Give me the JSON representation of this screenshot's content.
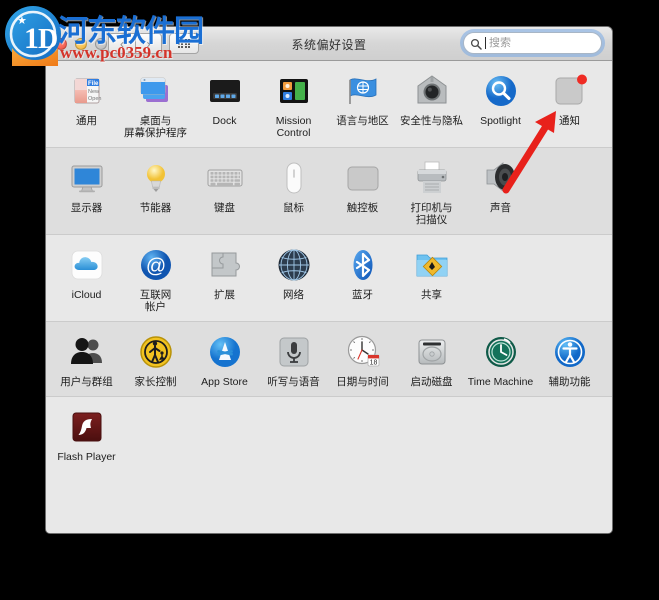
{
  "window": {
    "title": "系统偏好设置",
    "traffic_lights": [
      "close",
      "minimize",
      "zoom"
    ],
    "nav_back_label": "‹",
    "nav_forward_label": "›",
    "grid_button_name": "show-all"
  },
  "search": {
    "placeholder": "搜索",
    "value": "",
    "icon": "search-icon",
    "clear_icon": "clear-icon"
  },
  "watermark": {
    "site_name": "河东软件园",
    "url": "www.pc0359.cn",
    "brand_color": "#1a6fd4",
    "url_color": "#d4342a"
  },
  "annotation": {
    "arrow_color": "#e8211b",
    "points_to": "通知"
  },
  "sections": [
    {
      "name": "personal",
      "shade": "lite",
      "items": [
        {
          "label": "通用",
          "icon": "general-icon"
        },
        {
          "label": "桌面与\n屏幕保护程序",
          "icon": "desktop-screensaver-icon"
        },
        {
          "label": "Dock",
          "icon": "dock-icon"
        },
        {
          "label": "Mission\nControl",
          "icon": "mission-control-icon"
        },
        {
          "label": "语言与地区",
          "icon": "language-region-icon"
        },
        {
          "label": "安全性与隐私",
          "icon": "security-privacy-icon"
        },
        {
          "label": "Spotlight",
          "icon": "spotlight-icon"
        },
        {
          "label": "通知",
          "icon": "notifications-icon"
        }
      ]
    },
    {
      "name": "hardware",
      "shade": "alt",
      "items": [
        {
          "label": "显示器",
          "icon": "displays-icon"
        },
        {
          "label": "节能器",
          "icon": "energy-saver-icon"
        },
        {
          "label": "键盘",
          "icon": "keyboard-icon"
        },
        {
          "label": "鼠标",
          "icon": "mouse-icon"
        },
        {
          "label": "触控板",
          "icon": "trackpad-icon"
        },
        {
          "label": "打印机与\n扫描仪",
          "icon": "printers-scanners-icon"
        },
        {
          "label": "声音",
          "icon": "sound-icon"
        }
      ]
    },
    {
      "name": "internet-wireless",
      "shade": "lite",
      "items": [
        {
          "label": "iCloud",
          "icon": "icloud-icon"
        },
        {
          "label": "互联网\n帐户",
          "icon": "internet-accounts-icon"
        },
        {
          "label": "扩展",
          "icon": "extensions-icon"
        },
        {
          "label": "网络",
          "icon": "network-icon"
        },
        {
          "label": "蓝牙",
          "icon": "bluetooth-icon"
        },
        {
          "label": "共享",
          "icon": "sharing-icon"
        }
      ]
    },
    {
      "name": "system",
      "shade": "alt",
      "items": [
        {
          "label": "用户与群组",
          "icon": "users-groups-icon"
        },
        {
          "label": "家长控制",
          "icon": "parental-controls-icon"
        },
        {
          "label": "App Store",
          "icon": "app-store-icon"
        },
        {
          "label": "听写与语音",
          "icon": "dictation-speech-icon"
        },
        {
          "label": "日期与时间",
          "icon": "date-time-icon"
        },
        {
          "label": "启动磁盘",
          "icon": "startup-disk-icon"
        },
        {
          "label": "Time Machine",
          "icon": "time-machine-icon"
        },
        {
          "label": "辅助功能",
          "icon": "accessibility-icon"
        }
      ]
    },
    {
      "name": "other",
      "shade": "lite",
      "items": [
        {
          "label": "Flash Player",
          "icon": "flash-player-icon"
        }
      ]
    }
  ]
}
